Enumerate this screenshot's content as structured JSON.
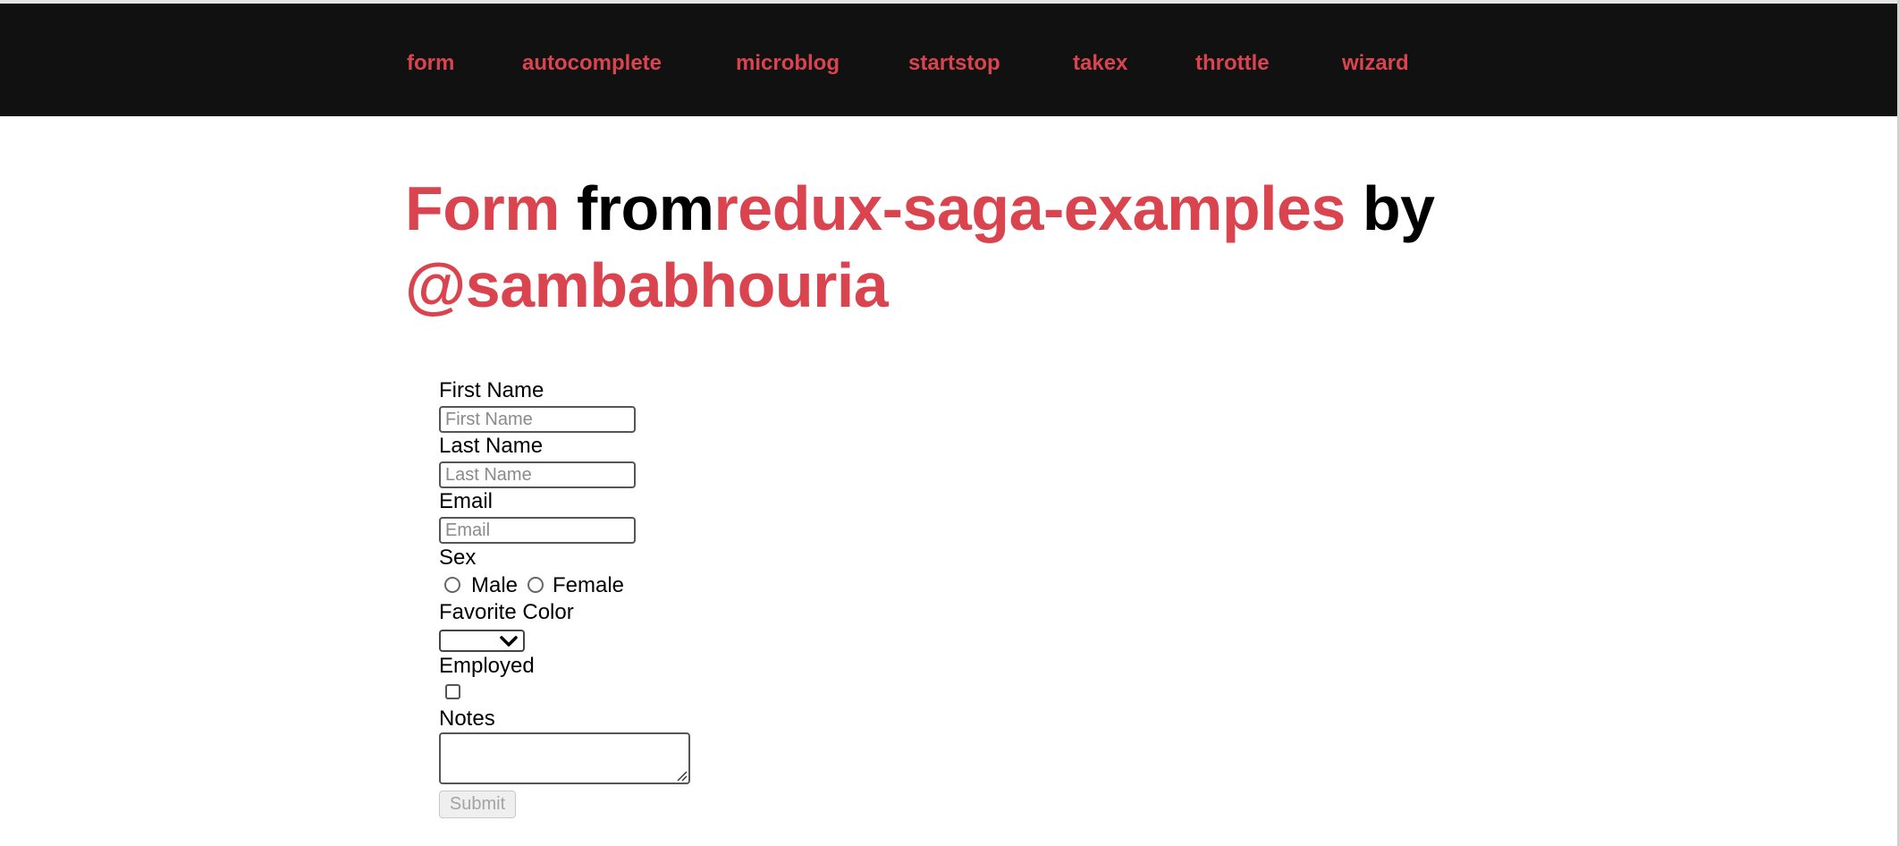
{
  "nav": {
    "items": [
      {
        "label": "form"
      },
      {
        "label": "autocomplete"
      },
      {
        "label": "microblog"
      },
      {
        "label": "startstop"
      },
      {
        "label": "takex"
      },
      {
        "label": "throttle"
      },
      {
        "label": "wizard"
      }
    ]
  },
  "heading": {
    "page": "Form",
    "from": "from",
    "repo": "redux-saga-examples",
    "by": "by",
    "author": "@sambabhouria"
  },
  "form": {
    "first_name": {
      "label": "First Name",
      "placeholder": "First Name",
      "value": ""
    },
    "last_name": {
      "label": "Last Name",
      "placeholder": "Last Name",
      "value": ""
    },
    "email": {
      "label": "Email",
      "placeholder": "Email",
      "value": ""
    },
    "sex": {
      "label": "Sex",
      "options": [
        "Male",
        "Female"
      ],
      "selected": null
    },
    "favorite_color": {
      "label": "Favorite Color",
      "selected": ""
    },
    "employed": {
      "label": "Employed",
      "checked": false
    },
    "notes": {
      "label": "Notes",
      "value": ""
    },
    "submit_label": "Submit",
    "submit_disabled": true
  },
  "colors": {
    "accent": "#d9444e",
    "navbar_bg": "#111111",
    "text": "#000000"
  }
}
